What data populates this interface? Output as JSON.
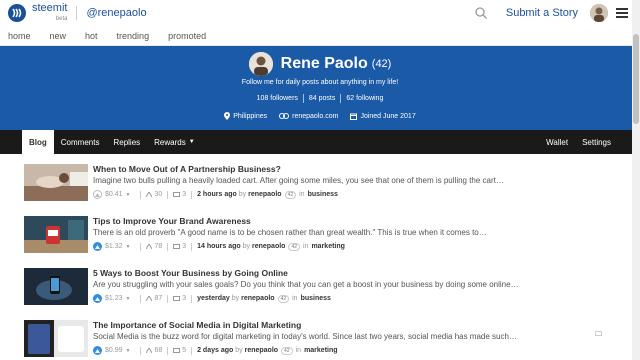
{
  "header": {
    "brand": "steemit",
    "beta": "beta",
    "username": "@renepaolo",
    "submit_label": "Submit a Story",
    "icons": {
      "logo": "steemit-logo-icon",
      "search": "search-icon",
      "menu": "hamburger-menu-icon"
    },
    "colors": {
      "brand": "#1a5099"
    }
  },
  "subnav": {
    "items": [
      "home",
      "new",
      "hot",
      "trending",
      "promoted"
    ]
  },
  "profile": {
    "name": "Rene Paolo",
    "reputation": "(42)",
    "bio": "Follow me for daily posts about anything in my life!",
    "followers": "108 followers",
    "posts": "84 posts",
    "following": "62 following",
    "location": "Philippines",
    "website": "renepaolo.com",
    "joined": "Joined June 2017",
    "banner_color": "#1b5aa6"
  },
  "tabs": {
    "blog": "Blog",
    "comments": "Comments",
    "replies": "Replies",
    "rewards": "Rewards",
    "wallet": "Wallet",
    "settings": "Settings"
  },
  "posts": [
    {
      "title": "When to Move Out of A Partnership Business?",
      "excerpt": "Imagine two bulls pulling a heavily loaded cart. After going some miles, you see that one of them is pulling the cart…",
      "payout": "$0.41",
      "votes": "30",
      "replies": "3",
      "time": "2 hours ago",
      "by": "by",
      "author": "renepaolo",
      "author_rep": "42",
      "in": "in",
      "category": "business",
      "voted": false
    },
    {
      "title": "Tips to Improve Your Brand Awareness",
      "excerpt": "There is an old proverb \"A good name is to be chosen rather than great wealth.\" This is true when it comes to…",
      "payout": "$1.32",
      "votes": "78",
      "replies": "3",
      "time": "14 hours ago",
      "by": "by",
      "author": "renepaolo",
      "author_rep": "42",
      "in": "in",
      "category": "marketing",
      "voted": true
    },
    {
      "title": "5 Ways to Boost Your Business by Going Online",
      "excerpt": "Are you struggling with your sales goals? Do you think that you can get a boost in your business by doing some online…",
      "payout": "$1.23",
      "votes": "87",
      "replies": "3",
      "time": "yesterday",
      "by": "by",
      "author": "renepaolo",
      "author_rep": "42",
      "in": "in",
      "category": "business",
      "voted": true
    },
    {
      "title": "The Importance of Social Media in Digital Marketing",
      "excerpt": "Social Media is the buzz word for digital marketing in today's world. Since last two years, social media has made such…",
      "payout": "$0.99",
      "votes": "68",
      "replies": "5",
      "time": "2 days ago",
      "by": "by",
      "author": "renepaolo",
      "author_rep": "42",
      "in": "in",
      "category": "marketing",
      "voted": true
    }
  ]
}
